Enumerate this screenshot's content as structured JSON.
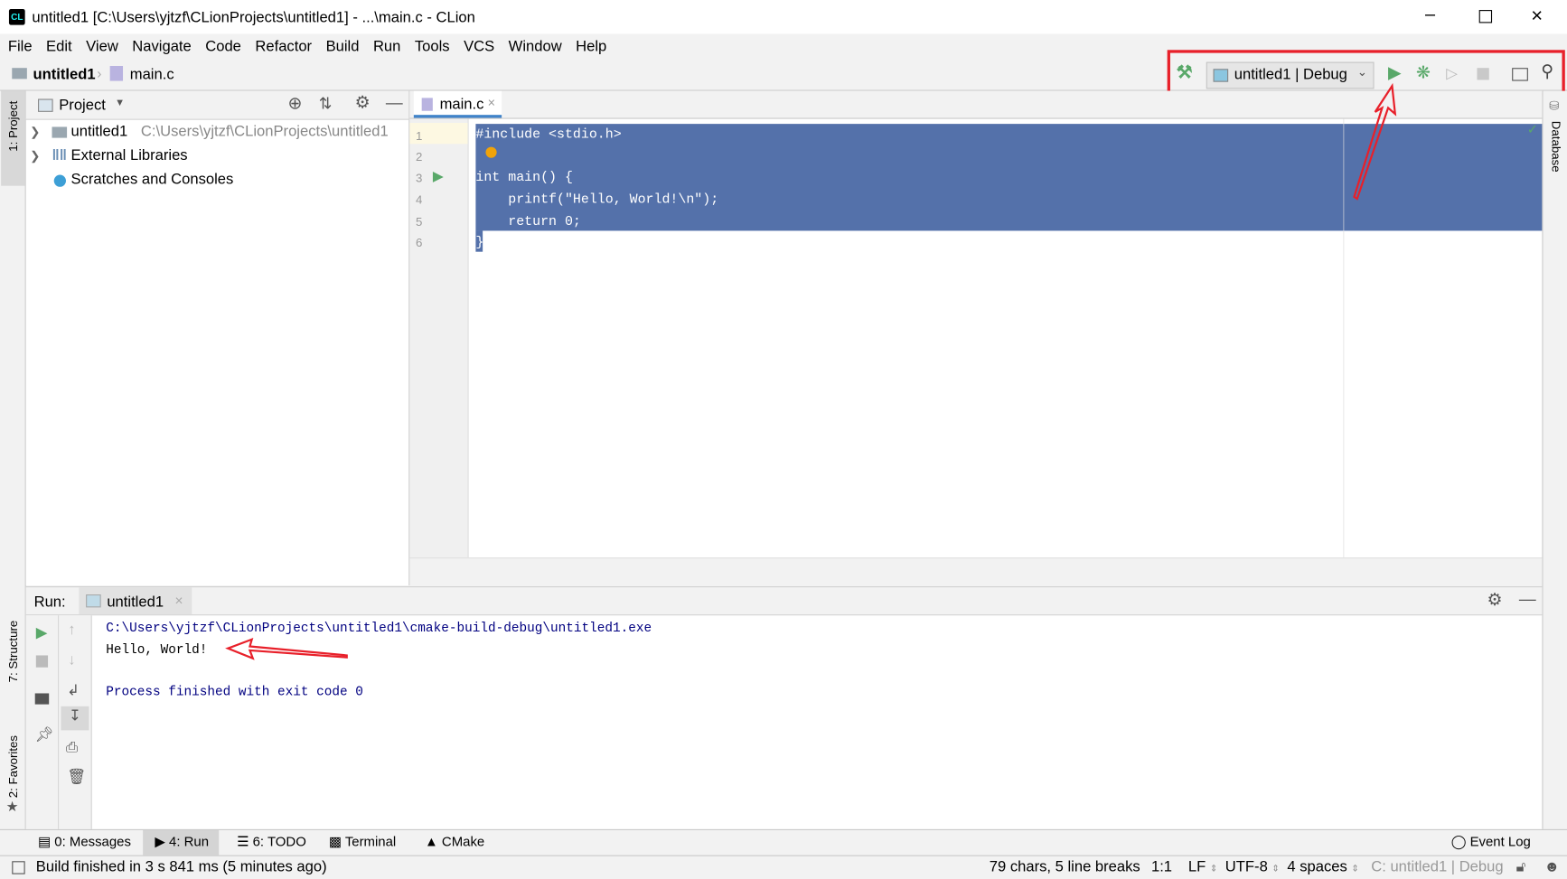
{
  "window": {
    "title": "untitled1 [C:\\Users\\yjtzf\\CLionProjects\\untitled1] - ...\\main.c - CLion",
    "app_icon": "clion-icon"
  },
  "menu": [
    "File",
    "Edit",
    "View",
    "Navigate",
    "Code",
    "Refactor",
    "Build",
    "Run",
    "Tools",
    "VCS",
    "Window",
    "Help"
  ],
  "breadcrumb": {
    "project": "untitled1",
    "file": "main.c"
  },
  "toolbar": {
    "config": "untitled1 | Debug",
    "icons": [
      "build-hammer-icon",
      "run-icon",
      "debug-icon",
      "coverage-icon",
      "stop-icon",
      "terminal-icon",
      "search-icon"
    ]
  },
  "left_stripe": {
    "project": "1: Project",
    "structure": "7: Structure",
    "favorites": "2: Favorites"
  },
  "right_stripe": {
    "database": "Database"
  },
  "project_panel": {
    "title": "Project",
    "items": [
      {
        "label": "untitled1",
        "path": "C:\\Users\\yjtzf\\CLionProjects\\untitled1"
      },
      {
        "label": "External Libraries"
      },
      {
        "label": "Scratches and Consoles"
      }
    ]
  },
  "editor": {
    "tab": "main.c",
    "line_numbers": [
      "1",
      "2",
      "3",
      "4",
      "5",
      "6"
    ],
    "lines": [
      "#include <stdio.h>",
      "",
      "int main() {",
      "    printf(\"Hello, World!\\n\");",
      "    return 0;",
      "}"
    ],
    "selection_color": "#5471aa"
  },
  "run_panel": {
    "label": "Run:",
    "tab": "untitled1",
    "output": [
      "C:\\Users\\yjtzf\\CLionProjects\\untitled1\\cmake-build-debug\\untitled1.exe",
      "Hello, World!",
      "",
      "Process finished with exit code 0"
    ]
  },
  "bottom_tabs": [
    "0: Messages",
    "4: Run",
    "6: TODO",
    "Terminal",
    "CMake"
  ],
  "event_log": "Event Log",
  "status": {
    "message": "Build finished in 3 s 841 ms (5 minutes ago)",
    "chars": "79 chars, 5 line breaks",
    "position": "1:1",
    "line_sep": "LF",
    "encoding": "UTF-8",
    "indent": "4 spaces",
    "context": "C: untitled1 | Debug"
  },
  "annotation_color": "#e8202a"
}
